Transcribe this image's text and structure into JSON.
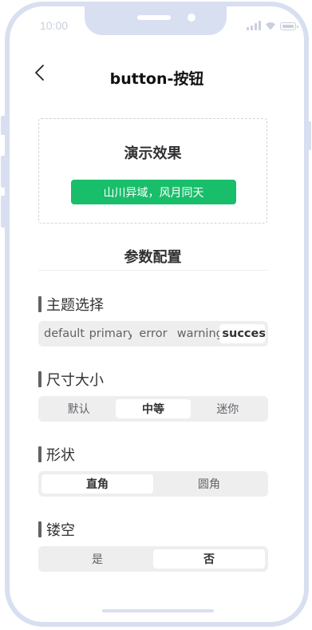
{
  "status_bar": {
    "time": "10:00"
  },
  "nav": {
    "title": "button-按钮",
    "back_icon": "chevron-left-icon"
  },
  "demo": {
    "title": "演示效果",
    "button_label": "山川异域，风月同天",
    "button_color": "#19be6b"
  },
  "params": {
    "title": "参数配置"
  },
  "theme": {
    "title": "主题选择",
    "options": [
      "default",
      "primary",
      "error",
      "warning",
      "success"
    ],
    "selected": "success"
  },
  "size": {
    "title": "尺寸大小",
    "options": [
      "默认",
      "中等",
      "迷你"
    ],
    "selected": "中等"
  },
  "shape": {
    "title": "形状",
    "options": [
      "直角",
      "圆角"
    ],
    "selected": "直角"
  },
  "plain": {
    "title": "镂空",
    "options": [
      "是",
      "否"
    ],
    "selected": "否"
  },
  "colors": {
    "frame": "#d8dff0",
    "success": "#19be6b",
    "segment_bg": "#eeeeef",
    "text_primary": "#303133"
  }
}
